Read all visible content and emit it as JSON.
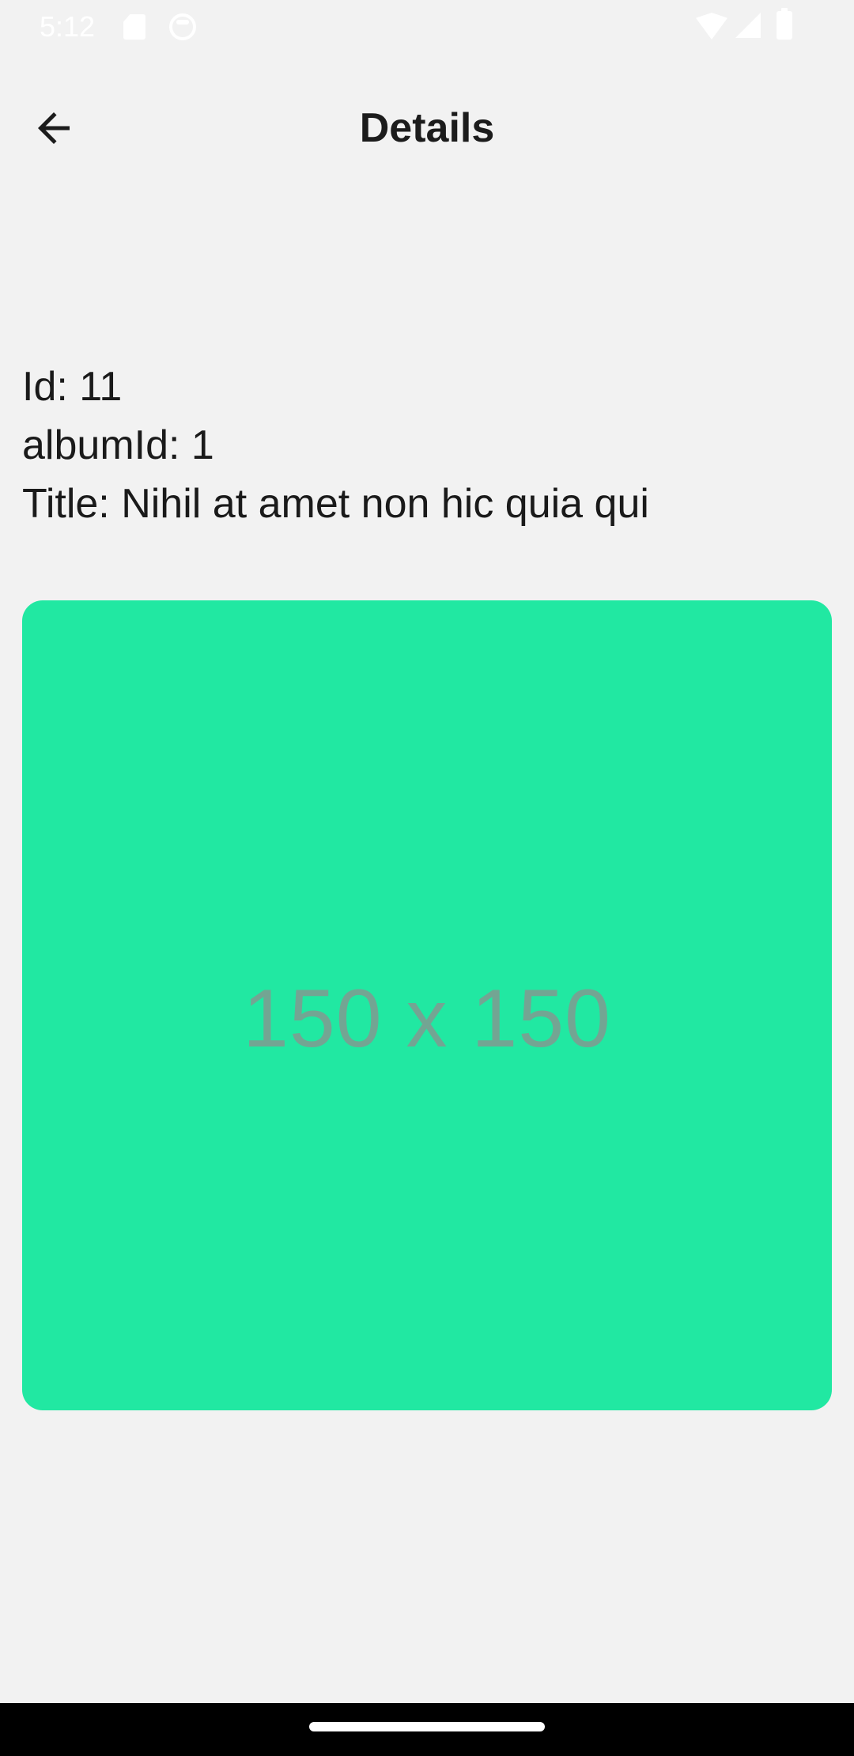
{
  "status_bar": {
    "time": "5:12",
    "icons": [
      "sd-card-icon",
      "cat-face-icon",
      "wifi-icon",
      "signal-icon",
      "battery-icon"
    ]
  },
  "app_bar": {
    "back_icon": "arrow-back-icon",
    "title": "Details"
  },
  "details": {
    "id_line": "Id: 11",
    "album_line": "albumId: 1",
    "title_line": "Title: Nihil at amet non hic quia qui"
  },
  "image": {
    "placeholder_text": "150 x 150",
    "background_color": "#21E8A2"
  },
  "colors": {
    "background": "#F2F2F2",
    "text": "#1A1A1A",
    "nav_bar": "#000000"
  }
}
